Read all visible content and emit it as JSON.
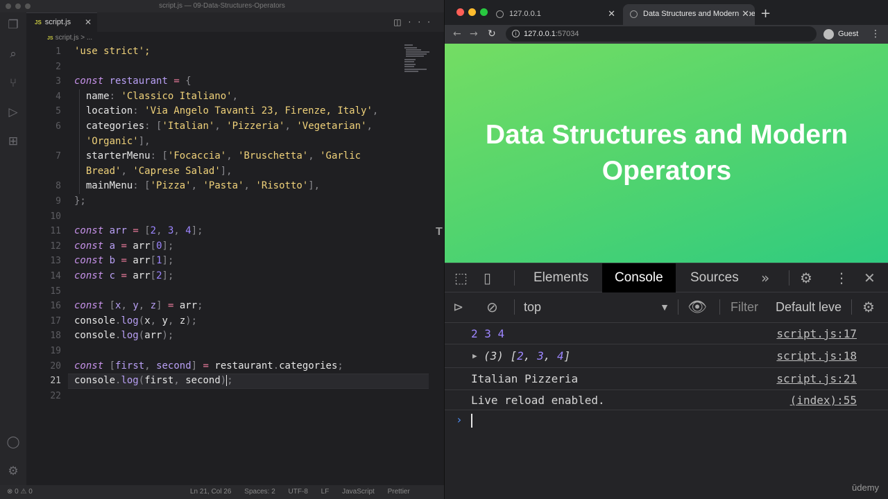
{
  "vscode": {
    "window_title": "script.js — 09-Data-Structures-Operators",
    "tab_label": "script.js",
    "tab_icon_text": "JS",
    "breadcrumb_file": "script.js",
    "breadcrumb_rest": "> ...",
    "line_numbers": [
      "1",
      "2",
      "3",
      "4",
      "5",
      "6",
      "",
      "7",
      "",
      "8",
      "9",
      "10",
      "11",
      "12",
      "13",
      "14",
      "15",
      "16",
      "17",
      "18",
      "19",
      "20",
      "21",
      "22"
    ],
    "status": {
      "problems": "⊗ 0 ⚠ 0",
      "position": "Ln 21, Col 26",
      "spaces": "Spaces: 2",
      "encoding": "UTF-8",
      "eol": "LF",
      "language": "JavaScript",
      "formatter": "Prettier"
    },
    "side_letter": "T"
  },
  "code_lines": [
    "'use strict';",
    "",
    "const restaurant = {",
    "  name: 'Classico Italiano',",
    "  location: 'Via Angelo Tavanti 23, Firenze, Italy',",
    "  categories: ['Italian', 'Pizzeria', 'Vegetarian',",
    "  'Organic'],",
    "  starterMenu: ['Focaccia', 'Bruschetta', 'Garlic",
    "  Bread', 'Caprese Salad'],",
    "  mainMenu: ['Pizza', 'Pasta', 'Risotto'],",
    "};",
    "",
    "const arr = [2, 3, 4];",
    "const a = arr[0];",
    "const b = arr[1];",
    "const c = arr[2];",
    "",
    "const [x, y, z] = arr;",
    "console.log(x, y, z);",
    "console.log(arr);",
    "",
    "const [first, second] = restaurant.categories;",
    "console.log(first, second);",
    ""
  ],
  "browser": {
    "tab1_title": "127.0.0.1",
    "tab2_title": "Data Structures and Modern Operators",
    "url_host": "127.0.0.1",
    "url_port": ":57034",
    "profile": "Guest",
    "page_heading": "Data Structures and Modern Operators"
  },
  "devtools": {
    "tabs": [
      "Elements",
      "Console",
      "Sources"
    ],
    "active_tab": "Console",
    "context": "top",
    "filter_placeholder": "Filter",
    "levels": "Default levels"
  },
  "console_messages": [
    {
      "text": "2 3 4",
      "source": "script.js:17"
    },
    {
      "text": "(3) [2, 3, 4]",
      "source": "script.js:18"
    },
    {
      "text": "Italian Pizzeria",
      "source": "script.js:21"
    },
    {
      "text": "Live reload enabled.",
      "source": "(index):55"
    }
  ],
  "watermark": "ūdemy"
}
